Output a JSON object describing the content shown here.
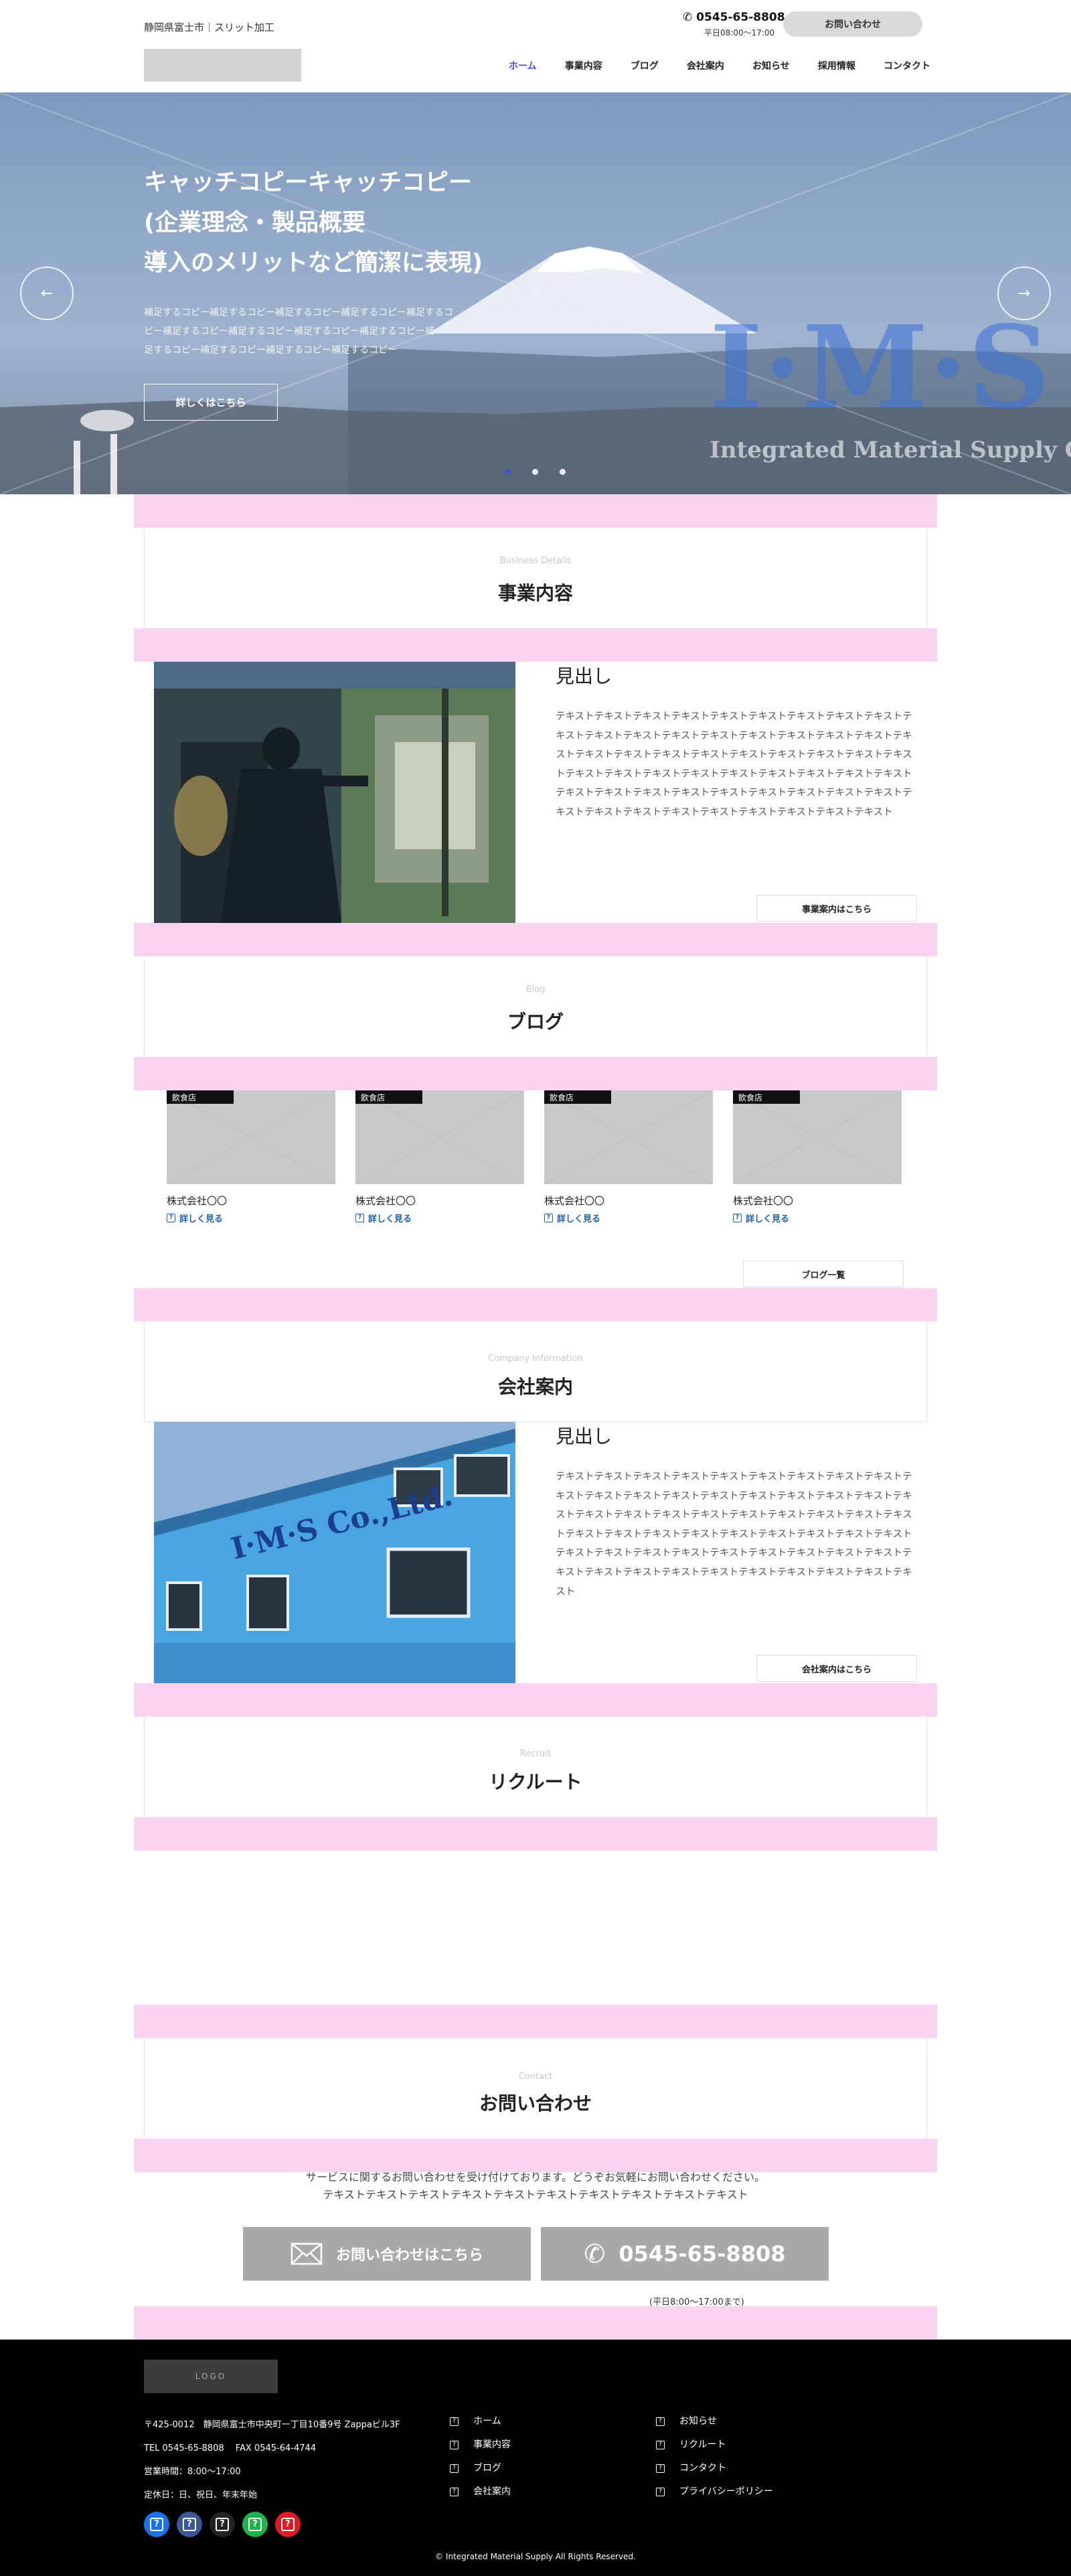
{
  "header": {
    "site_tag": "静岡県富士市｜スリット加工",
    "phone": "0545-65-8808",
    "hours": "平日08:00〜17:00",
    "contact_button": "お問い合わせ",
    "nav": [
      "ホーム",
      "事業内容",
      "ブログ",
      "会社案内",
      "お知らせ",
      "採用情報",
      "コンタクト"
    ]
  },
  "hero": {
    "title_lines": [
      "キャッチコピーキャッチコピー",
      "(企業理念・製品概要",
      "導入のメリットなど簡潔に表現)"
    ],
    "sub_lines": [
      "補足するコピー補足するコピー補足するコピー補足するコピー補足するコ",
      "ピー補足するコピー補足するコピー補足するコピー補足するコピー補",
      "足するコピー補足するコピー補足するコピー補足するコピー"
    ],
    "button": "詳しくはこちら",
    "prev_icon": "arrow-left-icon",
    "next_icon": "arrow-right-icon",
    "watermark_big": "I·M·S",
    "watermark_sub": "Integrated Material Supply Co.",
    "slides_active": 1
  },
  "business": {
    "en": "Business Details",
    "ja": "事業内容",
    "heading": "見出し",
    "body": "テキストテキストテキストテキストテキストテキストテキストテキストテキストテキストテキストテキストテキストテキストテキストテキストテキストテキストテキストテキストテキストテキストテキストテキストテキストテキストテキストテキストテキストテキストテキストテキストテキストテキストテキストテキストテキストテキストテキストテキストテキストテキストテキストテキストテキストテキストテキストテキストテキストテキストテキストテキストテキストテキストテキスト",
    "button": "事業案内はこちら"
  },
  "blog": {
    "en": "Blog",
    "ja": "ブログ",
    "cards": [
      {
        "tag": "飲食店",
        "name": "株式会社〇〇",
        "more": "詳しく見る"
      },
      {
        "tag": "飲食店",
        "name": "株式会社〇〇",
        "more": "詳しく見る"
      },
      {
        "tag": "飲食店",
        "name": "株式会社〇〇",
        "more": "詳しく見る"
      },
      {
        "tag": "飲食店",
        "name": "株式会社〇〇",
        "more": "詳しく見る"
      }
    ],
    "list_button": "ブログ一覧"
  },
  "company": {
    "en": "Company Information",
    "ja": "会社案内",
    "heading": "見出し",
    "body": "テキストテキストテキストテキストテキストテキストテキストテキストテキストテキストテキストテキストテキストテキストテキストテキストテキストテキストテキストテキストテキストテキストテキストテキストテキストテキストテキストテキストテキストテキストテキストテキストテキストテキストテキストテキストテキストテキストテキストテキストテキストテキストテキストテキストテキストテキストテキストテキストテキストテキストテキストテキストテキストテキストテキストテキスト",
    "button": "会社案内はこちら",
    "sign_text": "I·M·S Co.,Ltd."
  },
  "recruit": {
    "en": "Recruit",
    "ja": "リクルート"
  },
  "contact": {
    "en": "Contact",
    "ja": "お問い合わせ",
    "line1": "サービスに関するお問い合わせを受け付けております。どうぞお気軽にお問い合わせください。",
    "line2": "テキストテキストテキストテキストテキストテキストテキストテキストテキストテキスト",
    "form_button": "お問い合わせはこちら",
    "phone_button": "0545-65-8808",
    "hours_note": "(平日8:00〜17:00まで)"
  },
  "footer": {
    "logo": "LOGO",
    "address": "〒425-0012　静岡県富士市中央町一丁目10番9号 Zappaビル3F",
    "tel_fax": "TEL 0545-65-8808　 FAX 0545-64-4744",
    "business_hours": "営業時間：8:00〜17:00",
    "holidays": "定休日：日、祝日、年末年始",
    "links_col1": [
      "ホーム",
      "事業内容",
      "ブログ",
      "会社案内"
    ],
    "links_col2": [
      "お知らせ",
      "リクルート",
      "コンタクト",
      "プライバシーポリシー"
    ],
    "social_colors": [
      "#1a73e8",
      "#3b5998",
      "#222222",
      "#1bb34a",
      "#e01b24"
    ],
    "copyright": "© Integrated Material Supply All Rights Reserved."
  }
}
